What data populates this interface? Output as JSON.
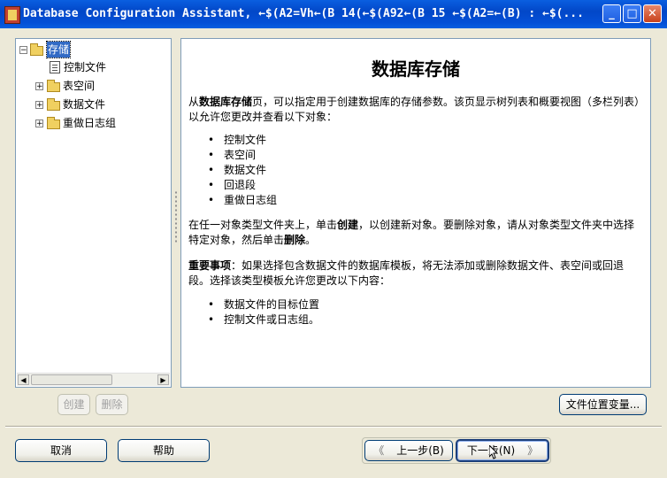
{
  "window": {
    "title": "Database Configuration Assistant, ←$(A2=Vh←(B 14(←$(A92←(B 15 ←$(A2=←(B) : ←$(...",
    "minimize_glyph": "_",
    "maximize_glyph": "□",
    "close_glyph": "✕"
  },
  "tree": {
    "root": {
      "label": "存储",
      "expander": "−"
    },
    "children": [
      {
        "label": "控制文件"
      },
      {
        "label": "表空间",
        "expander": "+"
      },
      {
        "label": "数据文件",
        "expander": "+"
      },
      {
        "label": "重做日志组",
        "expander": "+"
      }
    ],
    "scroll_left": "◀",
    "scroll_right": "▶"
  },
  "content": {
    "heading": "数据库存储",
    "intro_prefix": "从",
    "intro_bold": "数据库存储",
    "intro_suffix": "页，可以指定用于创建数据库的存储参数。该页显示树列表和概要视图（多栏列表）以允许您更改并查看以下对象：",
    "objects": [
      "控制文件",
      "表空间",
      "数据文件",
      "回退段",
      "重做日志组"
    ],
    "create_p1": "在任一对象类型文件夹上，单击",
    "create_bold": "创建",
    "create_p2": "，以创建新对象。要删除对象，请从对象类型文件夹中选择特定对象，然后单击",
    "delete_bold": "删除",
    "create_p3": "。",
    "important_bold": "重要事项",
    "important_text": "：如果选择包含数据文件的数据库模板，将无法添加或删除数据文件、表空间或回退段。选择该类型模板允许您更改以下内容：",
    "changes": [
      "数据文件的目标位置",
      "控制文件或日志组。"
    ]
  },
  "buttons": {
    "create": "创建",
    "delete": "删除",
    "file_location": "文件位置变量...",
    "cancel": "取消",
    "help": "帮助",
    "back": "上一步(B)",
    "next": "下一步(N)",
    "back_chevron": "《",
    "next_chevron": "》"
  }
}
